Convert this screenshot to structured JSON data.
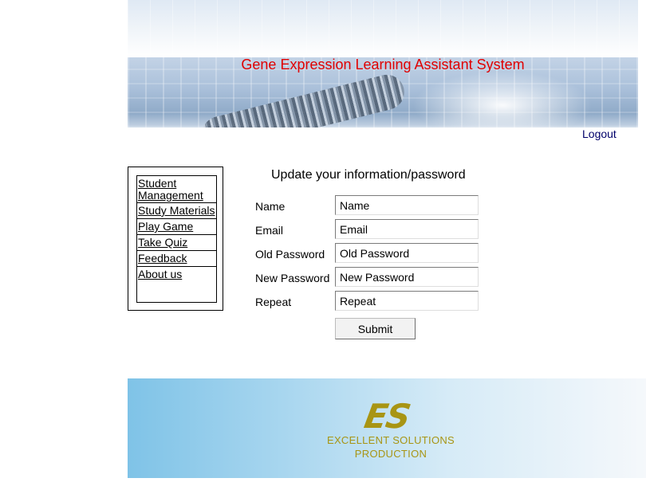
{
  "header": {
    "title": "Gene Expression Learning Assistant System",
    "logout_label": "Logout"
  },
  "sidebar": {
    "items": [
      {
        "label": "Student Management"
      },
      {
        "label": "Study Materials"
      },
      {
        "label": "Play Game"
      },
      {
        "label": "Take Quiz"
      },
      {
        "label": "Feedback"
      },
      {
        "label": "About us"
      }
    ]
  },
  "form": {
    "title": "Update your information/password",
    "fields": [
      {
        "label": "Name",
        "value": "Name"
      },
      {
        "label": "Email",
        "value": "Email"
      },
      {
        "label": "Old Password",
        "value": "Old Password"
      },
      {
        "label": "New Password",
        "value": "New Password"
      },
      {
        "label": "Repeat",
        "value": "Repeat"
      }
    ],
    "submit_label": "Submit"
  },
  "footer": {
    "logo_letters": "ES",
    "company_line1": "EXCELLENT SOLUTIONS",
    "company_line2": "PRODUCTION",
    "brand_color": "#a89514"
  },
  "colors": {
    "title": "#e00000",
    "link": "#00006a"
  }
}
